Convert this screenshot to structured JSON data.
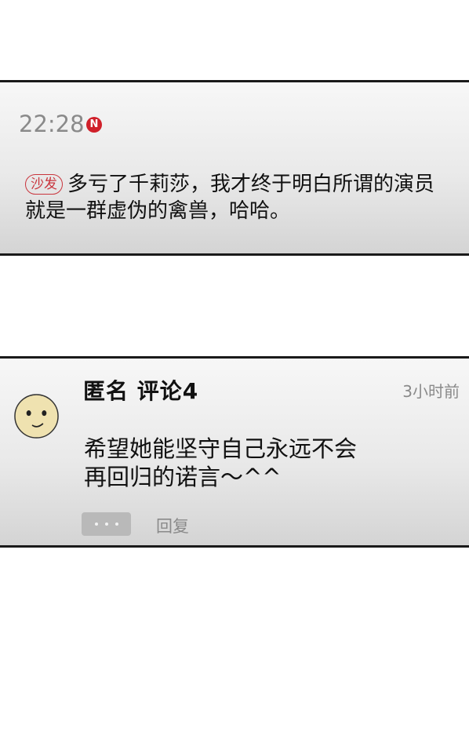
{
  "comment_top": {
    "time": "22:28",
    "badge": "N",
    "tag": "沙发",
    "text": "多亏了千莉莎，我才终于明白所谓的演员就是一群虚伪的禽兽，哈哈。"
  },
  "comment_bottom": {
    "author": "匿名  评论4",
    "time_ago": "3小时前",
    "text_line1": "希望她能坚守自己永远不会",
    "text_line2": "再回归的诺言～^^",
    "reply_label": "回复"
  },
  "icons": {
    "avatar": "smiley-face-icon",
    "more": "more-dots-icon",
    "new_badge": "n-badge-icon"
  },
  "colors": {
    "badge_red": "#d0202a",
    "tag_red": "#c9353d",
    "muted_gray": "#8a8a8a",
    "avatar_fill": "#efe2b0"
  }
}
